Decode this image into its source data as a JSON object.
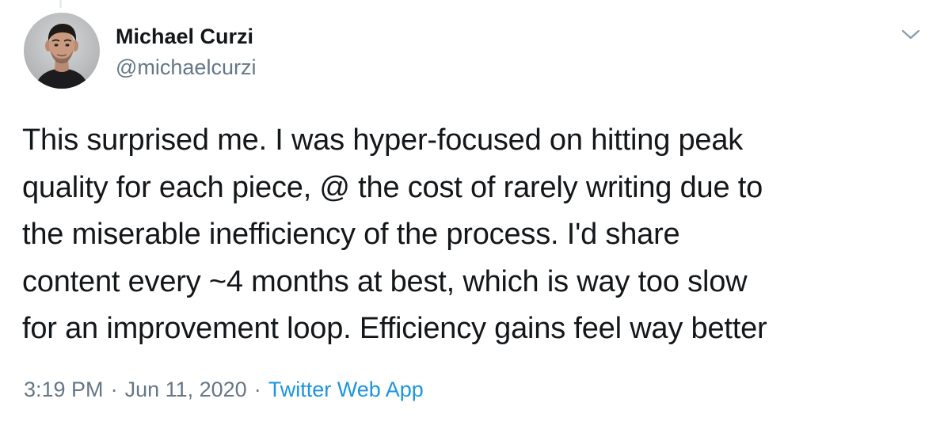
{
  "tweet": {
    "author": {
      "name": "Michael Curzi",
      "handle": "@michaelcurzi"
    },
    "text_lines": [
      "This surprised me. I was hyper-focused on hitting peak",
      "quality for each piece, @ the cost of rarely writing due to",
      "the miserable inefficiency of the process. I'd share",
      "content every ~4 months at best, which is way too slow",
      "for an improvement loop. Efficiency gains feel way better"
    ],
    "time": "3:19 PM",
    "date": "Jun 11, 2020",
    "separator": "·",
    "source": "Twitter Web App"
  },
  "icons": {
    "more": "chevron-down-icon"
  },
  "colors": {
    "text": "#14171a",
    "secondary": "#657786",
    "link": "#1b95e0",
    "thread_line": "#e6ecf0"
  }
}
